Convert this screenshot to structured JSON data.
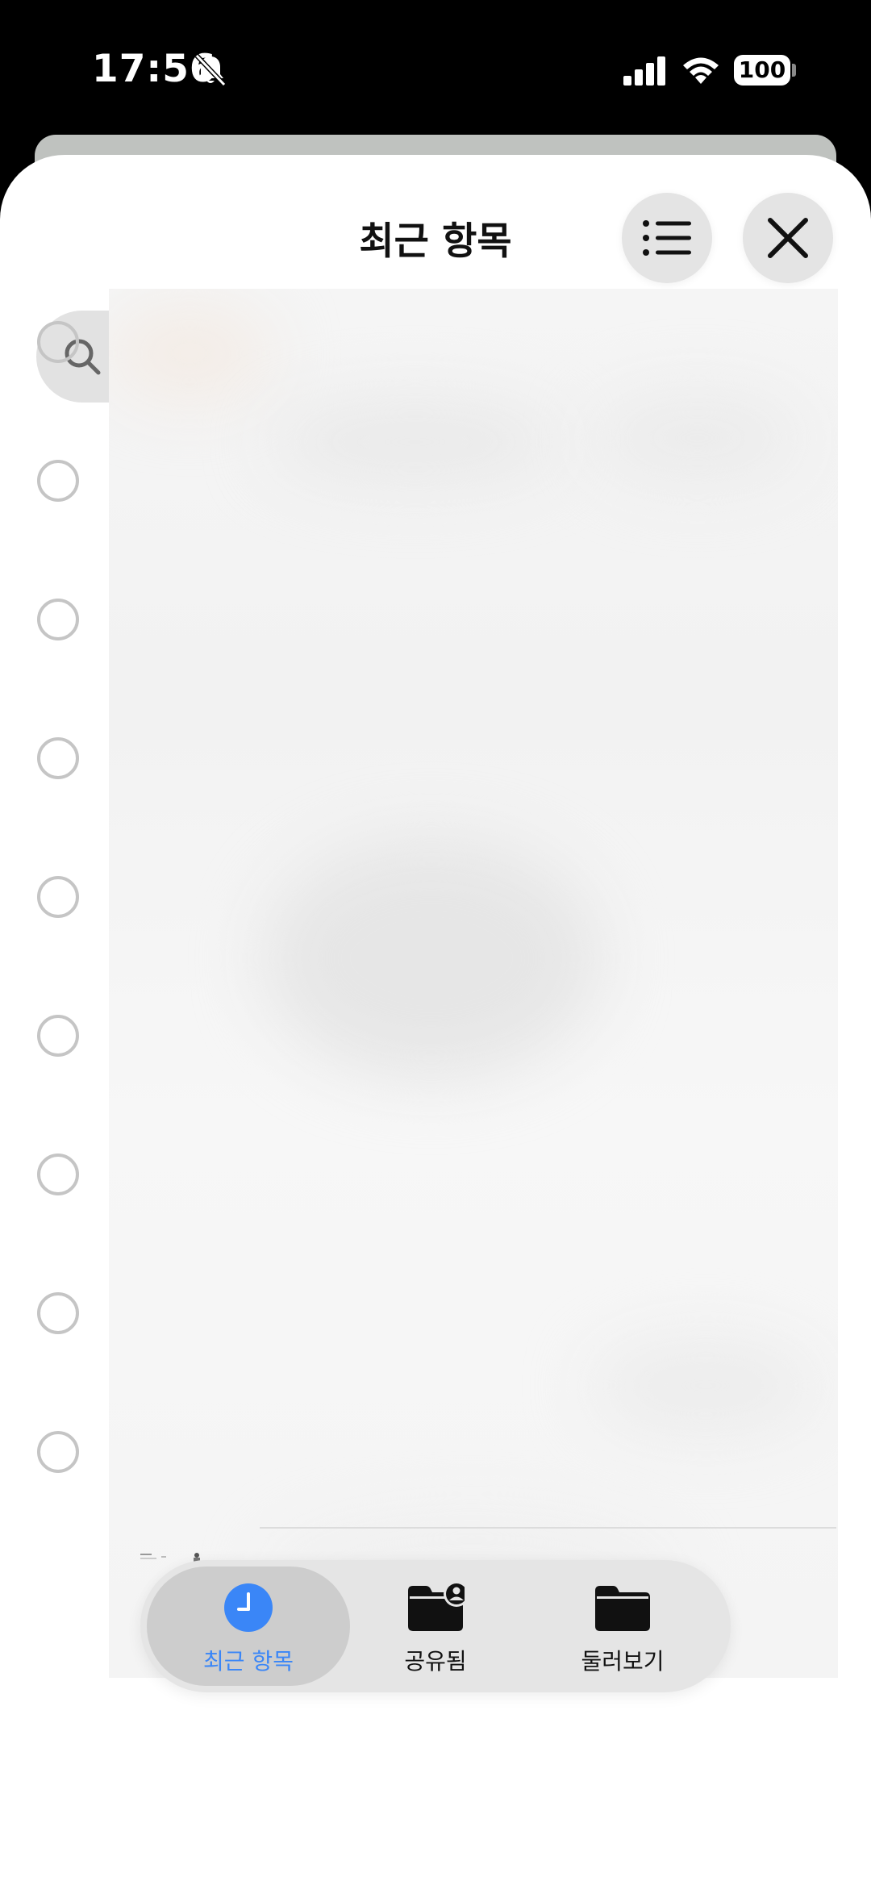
{
  "status_bar": {
    "time": "17:56",
    "battery": "100"
  },
  "header": {
    "title": "최근 항목",
    "list_button_icon": "list-icon",
    "close_button_icon": "close-icon"
  },
  "search": {
    "placeholder": "검색",
    "value": ""
  },
  "list": {
    "row_count": 9,
    "rows_selected": [
      false,
      false,
      false,
      false,
      false,
      false,
      false,
      false,
      false
    ]
  },
  "tab_bar": {
    "tabs": [
      {
        "label": "최근 항목",
        "icon": "clock-icon",
        "active": true
      },
      {
        "label": "공유됨",
        "icon": "shared-folder-icon",
        "active": false
      },
      {
        "label": "둘러보기",
        "icon": "folder-icon",
        "active": false
      }
    ]
  },
  "colors": {
    "accent": "#3A86F7",
    "sheet_background": "#FFFFFF",
    "status_bar_background": "#000000"
  }
}
